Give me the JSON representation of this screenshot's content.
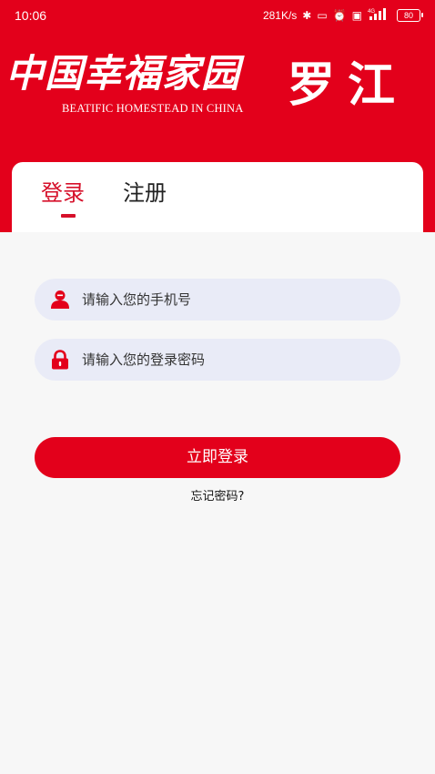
{
  "status_bar": {
    "time": "10:06",
    "network_speed": "281K/s",
    "signal_label": "4G",
    "battery": "80"
  },
  "header": {
    "brand_cn": "中国幸福家园",
    "brand_en": "BEATIFIC HOMESTEAD IN CHINA",
    "place": "罗江"
  },
  "tabs": [
    {
      "label": "登录",
      "active": true
    },
    {
      "label": "注册",
      "active": false
    }
  ],
  "form": {
    "phone_placeholder": "请输入您的手机号",
    "phone_value": "",
    "password_placeholder": "请输入您的登录密码",
    "password_value": "",
    "login_button_label": "立即登录",
    "forgot_password_label": "忘记密码?"
  },
  "colors": {
    "brand_red": "#e3001b",
    "tab_active": "#d6102a",
    "input_bg": "#e9ebf7",
    "page_bg": "#f7f7f7"
  }
}
